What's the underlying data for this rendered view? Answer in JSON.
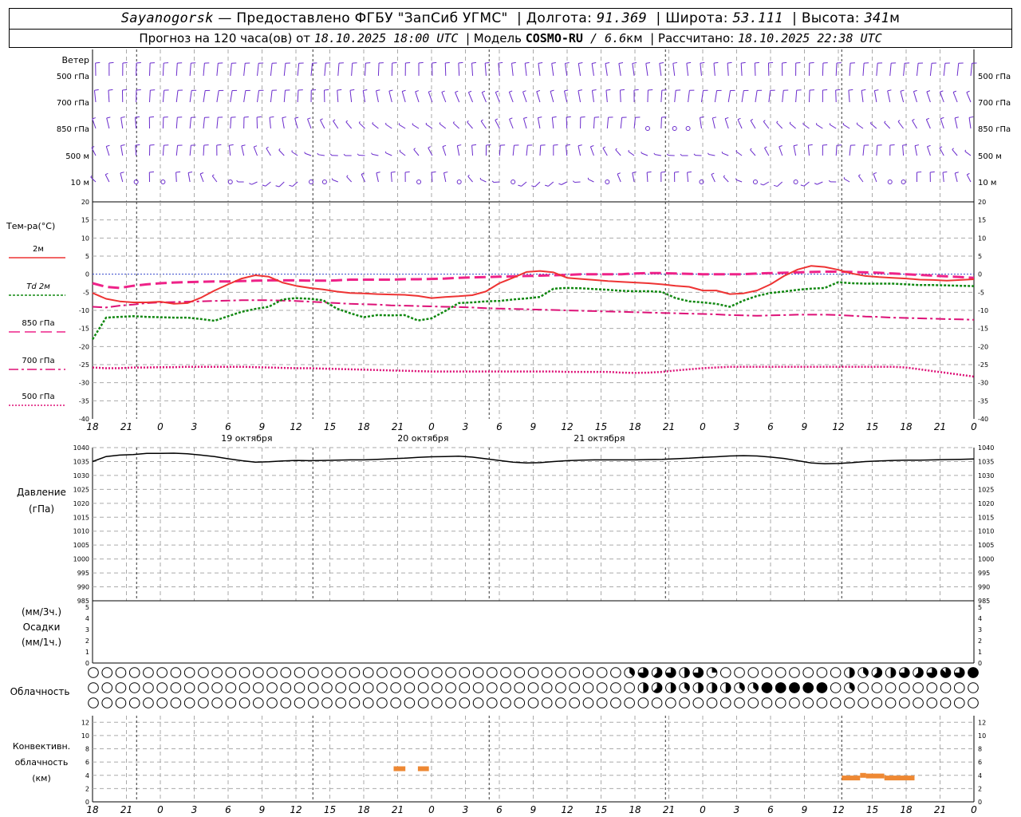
{
  "header": {
    "station": "Sayanogorsk",
    "provider": " — Предоставлено ФГБУ \"ЗапСиб УГМС\"",
    "lon_label": "Долгота: ",
    "lon_value": "91.369",
    "lat_label": "Широта: ",
    "lat_value": "53.111",
    "alt_label": "Высота: ",
    "alt_value": "341",
    "alt_unit": "м",
    "forecast_label": "Прогноз на 120 часа(ов) от ",
    "forecast_time": "18.10.2025 18:00 UTC",
    "model_label": "Модель ",
    "model_name": "COSMO-RU",
    "model_res": " / 6.6",
    "model_res_unit": "км",
    "calc_label": "Рассчитано: ",
    "calc_time": "18.10.2025 22:38 UTC"
  },
  "colors": {
    "t2m": "#ee3333",
    "td2m": "#118811",
    "t850": "#ee2288",
    "t700": "#dd1177",
    "t500": "#dd1177",
    "wind": "#6a2bcc",
    "conv": "#ee8833",
    "pressure": "#000000"
  },
  "chart_data": {
    "type": "line",
    "x_hours_ticks": [
      "18",
      "21",
      "0",
      "3",
      "6",
      "9",
      "12",
      "15",
      "18",
      "21",
      "0",
      "3",
      "6",
      "9",
      "12",
      "15",
      "18",
      "21",
      "0",
      "3",
      "6",
      "9",
      "12",
      "15",
      "18",
      "21",
      "0"
    ],
    "day_labels": [
      "19 октября",
      "20 октября",
      "21 октября"
    ],
    "wind_panel": {
      "title": "Ветер",
      "levels": [
        "500 гПа",
        "700 гПа",
        "850 гПа",
        "500 м",
        "10 м"
      ],
      "icon": "wind-barb-icon"
    },
    "temperature_panel": {
      "title": "Тем-ра(°C)",
      "ylim": [
        -40,
        20
      ],
      "yticks": [
        20,
        15,
        10,
        5,
        0,
        -5,
        -10,
        -15,
        -20,
        -25,
        -30,
        -35,
        -40
      ],
      "legend": [
        "2м",
        "Td  2м",
        "850 гПа",
        "700 гПа",
        "500 гПа"
      ],
      "series": [
        {
          "name": "2м",
          "values": [
            -5.2,
            -6.8,
            -7.5,
            -7.8,
            -7.8,
            -7.6,
            -8.2,
            -8.0,
            -6.5,
            -4.5,
            -2.8,
            -1.2,
            -0.3,
            -0.7,
            -2.3,
            -3.2,
            -3.8,
            -4.2,
            -4.8,
            -5.2,
            -5.3,
            -5.5,
            -5.6,
            -5.7,
            -6.0,
            -6.6,
            -6.3,
            -6.1,
            -5.8,
            -4.8,
            -2.5,
            -1.0,
            0.6,
            0.9,
            0.5,
            -1.0,
            -1.3,
            -1.6,
            -1.9,
            -2.1,
            -2.3,
            -2.5,
            -2.8,
            -3.2,
            -3.5,
            -4.5,
            -4.5,
            -5.5,
            -5.3,
            -4.5,
            -2.8,
            -0.5,
            1.3,
            2.3,
            2.0,
            1.2,
            0.2,
            -0.5,
            -0.8,
            -1.0,
            -1.2,
            -1.5,
            -1.6,
            -1.8,
            -1.6,
            -1.4
          ]
        },
        {
          "name": "Td  2м",
          "values": [
            -18.0,
            -12.0,
            -11.8,
            -11.6,
            -11.8,
            -11.9,
            -12.0,
            -12.0,
            -12.4,
            -12.9,
            -11.6,
            -10.4,
            -9.6,
            -9.0,
            -7.0,
            -6.6,
            -6.8,
            -7.2,
            -9.5,
            -10.8,
            -11.9,
            -11.3,
            -11.4,
            -11.3,
            -12.8,
            -12.2,
            -10.2,
            -8.0,
            -7.8,
            -7.5,
            -7.4,
            -7.0,
            -6.7,
            -6.3,
            -4.0,
            -3.8,
            -3.9,
            -4.1,
            -4.3,
            -4.6,
            -4.7,
            -4.7,
            -4.9,
            -6.6,
            -7.5,
            -7.8,
            -8.2,
            -9.0,
            -7.3,
            -6.0,
            -5.2,
            -4.8,
            -4.3,
            -4.0,
            -3.8,
            -2.2,
            -2.5,
            -2.6,
            -2.6,
            -2.6,
            -2.8,
            -3.0,
            -3.0,
            -3.1,
            -3.2,
            -3.3
          ]
        },
        {
          "name": "850 гПа",
          "values": [
            -2.5,
            -3.5,
            -3.8,
            -3.2,
            -2.8,
            -2.5,
            -2.3,
            -2.2,
            -2.1,
            -2.0,
            -2.0,
            -1.9,
            -1.8,
            -1.7,
            -1.7,
            -1.7,
            -1.8,
            -1.8,
            -1.7,
            -1.5,
            -1.5,
            -1.5,
            -1.5,
            -1.4,
            -1.4,
            -1.3,
            -1.2,
            -1.0,
            -0.9,
            -0.8,
            -0.7,
            -0.6,
            -0.5,
            -0.4,
            -0.3,
            -0.2,
            0.0,
            0.0,
            0.0,
            0.0,
            0.2,
            0.3,
            0.3,
            0.2,
            0.1,
            0.0,
            0.0,
            0.0,
            0.0,
            0.2,
            0.3,
            0.4,
            0.5,
            0.6,
            0.7,
            0.7,
            0.6,
            0.5,
            0.4,
            0.2,
            0.0,
            -0.2,
            -0.4,
            -0.6,
            -0.8,
            -1.0
          ]
        },
        {
          "name": "700 гПа",
          "values": [
            -9.0,
            -9.2,
            -8.7,
            -8.4,
            -8.0,
            -7.8,
            -7.7,
            -7.6,
            -7.5,
            -7.4,
            -7.3,
            -7.2,
            -7.2,
            -7.2,
            -7.3,
            -7.4,
            -7.6,
            -7.8,
            -8.0,
            -8.2,
            -8.3,
            -8.4,
            -8.6,
            -8.7,
            -8.8,
            -8.9,
            -9.0,
            -9.1,
            -9.2,
            -9.4,
            -9.5,
            -9.6,
            -9.7,
            -9.8,
            -9.9,
            -10.0,
            -10.1,
            -10.2,
            -10.3,
            -10.4,
            -10.5,
            -10.6,
            -10.7,
            -10.8,
            -10.9,
            -11.0,
            -11.1,
            -11.3,
            -11.4,
            -11.5,
            -11.4,
            -11.3,
            -11.2,
            -11.2,
            -11.2,
            -11.3,
            -11.5,
            -11.7,
            -11.8,
            -12.0,
            -12.1,
            -12.2,
            -12.3,
            -12.4,
            -12.5,
            -12.6
          ]
        },
        {
          "name": "500 гПа",
          "values": [
            -25.8,
            -26.0,
            -26.0,
            -25.8,
            -25.8,
            -25.7,
            -25.7,
            -25.6,
            -25.6,
            -25.6,
            -25.6,
            -25.6,
            -25.7,
            -25.8,
            -25.9,
            -26.0,
            -26.0,
            -26.1,
            -26.2,
            -26.3,
            -26.4,
            -26.5,
            -26.6,
            -26.7,
            -26.8,
            -26.9,
            -26.9,
            -26.9,
            -26.9,
            -26.9,
            -26.9,
            -26.9,
            -26.9,
            -26.9,
            -26.9,
            -27.0,
            -27.0,
            -27.0,
            -27.0,
            -27.2,
            -27.3,
            -27.2,
            -27.0,
            -26.6,
            -26.3,
            -26.0,
            -25.8,
            -25.6,
            -25.6,
            -25.6,
            -25.6,
            -25.6,
            -25.6,
            -25.6,
            -25.6,
            -25.6,
            -25.6,
            -25.6,
            -25.6,
            -25.6,
            -25.8,
            -26.3,
            -26.8,
            -27.3,
            -27.8,
            -28.3
          ]
        }
      ]
    },
    "pressure_panel": {
      "title": "Давление",
      "unit": "(гПа)",
      "ylim": [
        985,
        1040
      ],
      "yticks": [
        1040,
        1035,
        1030,
        1025,
        1020,
        1015,
        1010,
        1005,
        1000,
        995,
        990,
        985
      ],
      "series": [
        {
          "name": "",
          "values": [
            1035.0,
            1036.8,
            1037.3,
            1037.5,
            1037.9,
            1037.9,
            1038.0,
            1037.8,
            1037.3,
            1036.8,
            1036.0,
            1035.3,
            1034.8,
            1034.9,
            1035.2,
            1035.4,
            1035.3,
            1035.4,
            1035.5,
            1035.6,
            1035.6,
            1035.8,
            1036.0,
            1036.2,
            1036.5,
            1036.7,
            1036.8,
            1036.9,
            1036.6,
            1036.0,
            1035.4,
            1034.8,
            1034.5,
            1034.6,
            1035.0,
            1035.3,
            1035.5,
            1035.6,
            1035.6,
            1035.6,
            1035.6,
            1035.7,
            1035.8,
            1036.0,
            1036.2,
            1036.5,
            1036.7,
            1037.0,
            1037.1,
            1037.0,
            1036.6,
            1036.1,
            1035.3,
            1034.5,
            1034.2,
            1034.3,
            1034.6,
            1035.0,
            1035.2,
            1035.4,
            1035.5,
            1035.5,
            1035.6,
            1035.7,
            1035.8,
            1035.9
          ]
        }
      ]
    },
    "precip_panel": {
      "unit_3h": "(мм/3ч.)",
      "title": "Осадки",
      "unit_1h": "(мм/1ч.)",
      "ylim": [
        0,
        5
      ],
      "yticks": [
        5,
        4,
        3,
        2,
        1,
        0
      ],
      "values": []
    },
    "cloud_panel": {
      "title": "Облачность",
      "rows": 3,
      "columns": 65,
      "icon": "cloud-cover-circle-icon",
      "cover_oktas": [
        [
          0,
          0,
          0,
          0,
          0,
          0,
          0,
          0,
          0,
          0,
          0,
          0,
          0,
          0,
          0,
          0,
          0,
          0,
          0,
          0,
          0,
          0,
          0,
          0,
          0,
          0,
          0,
          0,
          0,
          0,
          0,
          0,
          0,
          0,
          0,
          0,
          0,
          0,
          0,
          3,
          6,
          5,
          6,
          4,
          6,
          2,
          0,
          0,
          0,
          0,
          0,
          0,
          0,
          0,
          0,
          4,
          3,
          5,
          4,
          6,
          5,
          6,
          7,
          6,
          8,
          8,
          8,
          7,
          6,
          8,
          7,
          6,
          0,
          0,
          0
        ],
        [
          0,
          0,
          0,
          0,
          0,
          0,
          0,
          0,
          0,
          0,
          0,
          0,
          0,
          0,
          0,
          0,
          0,
          0,
          0,
          0,
          0,
          0,
          0,
          0,
          0,
          0,
          0,
          0,
          0,
          0,
          0,
          0,
          0,
          0,
          0,
          0,
          0,
          0,
          0,
          0,
          4,
          5,
          4,
          3,
          4,
          4,
          4,
          3,
          3,
          8,
          8,
          8,
          8,
          8,
          0,
          3,
          0,
          0,
          0,
          0,
          0,
          0,
          0,
          0,
          0,
          0,
          0,
          4,
          6,
          8,
          8,
          8,
          8,
          8,
          8,
          8,
          8,
          8,
          8,
          8
        ],
        [
          0,
          0,
          0,
          0,
          0,
          0,
          0,
          0,
          0,
          0,
          0,
          0,
          0,
          0,
          0,
          0,
          0,
          0,
          0,
          0,
          0,
          0,
          0,
          0,
          0,
          0,
          0,
          0,
          0,
          0,
          0,
          0,
          0,
          0,
          0,
          0,
          0,
          0,
          0,
          0,
          0,
          0,
          0,
          0,
          0,
          0,
          0,
          0,
          0,
          0,
          0,
          0,
          0,
          0,
          0,
          0,
          0,
          0,
          0,
          0,
          0,
          0,
          0,
          0,
          0
        ]
      ]
    },
    "convective_panel": {
      "title": "Конвективн.",
      "title2": "облачность",
      "unit": "(км)",
      "ylim": [
        0,
        13
      ],
      "yticks": [
        12,
        10,
        8,
        6,
        4,
        2,
        0
      ],
      "segments": [
        {
          "from_h": 41,
          "to_h": 42.6,
          "value": 5
        },
        {
          "from_h": 44.3,
          "to_h": 45.8,
          "value": 5
        },
        {
          "from_h": 102,
          "to_h": 103.6,
          "value": 3.6
        },
        {
          "from_h": 103.6,
          "to_h": 104.5,
          "value": 3.6
        },
        {
          "from_h": 104.5,
          "to_h": 105.3,
          "value": 4.0
        },
        {
          "from_h": 105.3,
          "to_h": 107.8,
          "value": 3.9
        },
        {
          "from_h": 107.8,
          "to_h": 111.9,
          "value": 3.6
        }
      ]
    }
  }
}
